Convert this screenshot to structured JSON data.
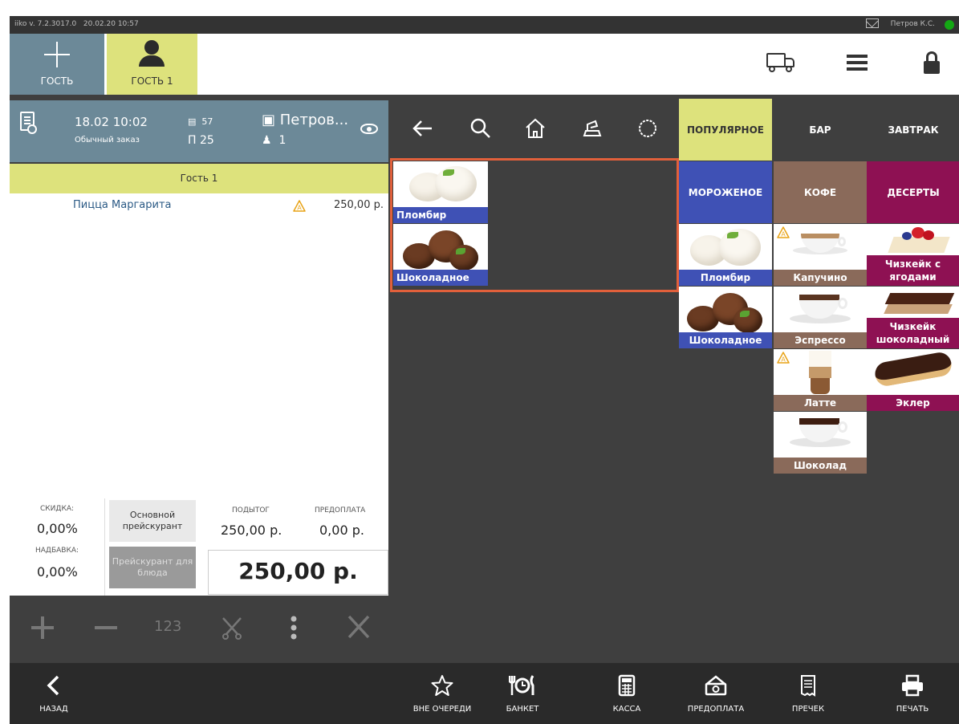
{
  "statusbar": {
    "version": "iiko v. 7.2.3017.0",
    "datetime": "20.02.20 10:57",
    "user": "Петров К.С."
  },
  "guestbar": {
    "add_guest_label": "ГОСТЬ",
    "guest_tab_label": "ГОСТЬ 1"
  },
  "order": {
    "date": "18.02 10:02",
    "order_type": "Обычный заказ",
    "number": "57",
    "table": "25",
    "waiter": "Петров...",
    "guests_count": "1",
    "guest_row": "Гость 1",
    "items": [
      {
        "name": "Пицца Маргарита",
        "price": "250,00 р."
      }
    ]
  },
  "totals": {
    "discount_label": "СКИДКА:",
    "discount_value": "0,00%",
    "surcharge_label": "НАДБАВКА:",
    "surcharge_value": "0,00%",
    "pricelist_main": "Основной прейскурант",
    "pricelist_dish": "Прейскурант для блюда",
    "subtotal_label": "ПОДЫТОГ",
    "subtotal_value": "250,00 р.",
    "prepay_label": "ПРЕДОПЛАТА",
    "prepay_value": "0,00 р.",
    "total": "250,00 р."
  },
  "actions": {
    "quantity_label": "123"
  },
  "search_results": [
    {
      "name": "Пломбир"
    },
    {
      "name": "Шоколадное"
    }
  ],
  "categories": [
    {
      "label": "ПОПУЛЯРНОЕ",
      "color": "#dde27c"
    },
    {
      "label": "БАР",
      "color": "#3f3f3f"
    },
    {
      "label": "ЗАВТРАК",
      "color": "#3f3f3f"
    },
    {
      "label": "МОРОЖЕНОЕ",
      "color": "#3f51b5"
    },
    {
      "label": "КОФЕ",
      "color": "#8a6a5a"
    },
    {
      "label": "ДЕСЕРТЫ",
      "color": "#8e1153"
    }
  ],
  "menu_items": {
    "icecream": [
      "Пломбир",
      "Шоколадное"
    ],
    "coffee": [
      "Капучино",
      "Эспрессо",
      "Латте",
      "Шоколад"
    ],
    "desserts": [
      "Чизкейк с ягодами",
      "Чизкейк шоколадный",
      "Эклер"
    ]
  },
  "bottombar": {
    "back": "НАЗАД",
    "out_of_turn": "ВНЕ ОЧЕРЕДИ",
    "banquet": "БАНКЕТ",
    "cash": "КАССА",
    "prepayment": "ПРЕДОПЛАТА",
    "precheck": "ПРЕЧЕК",
    "print": "ПЕЧАТЬ"
  },
  "colors": {
    "accent_yellow": "#dde27c",
    "header_blue_grey": "#6c8998",
    "highlight": "#e2603b",
    "status_online": "#14a814"
  }
}
